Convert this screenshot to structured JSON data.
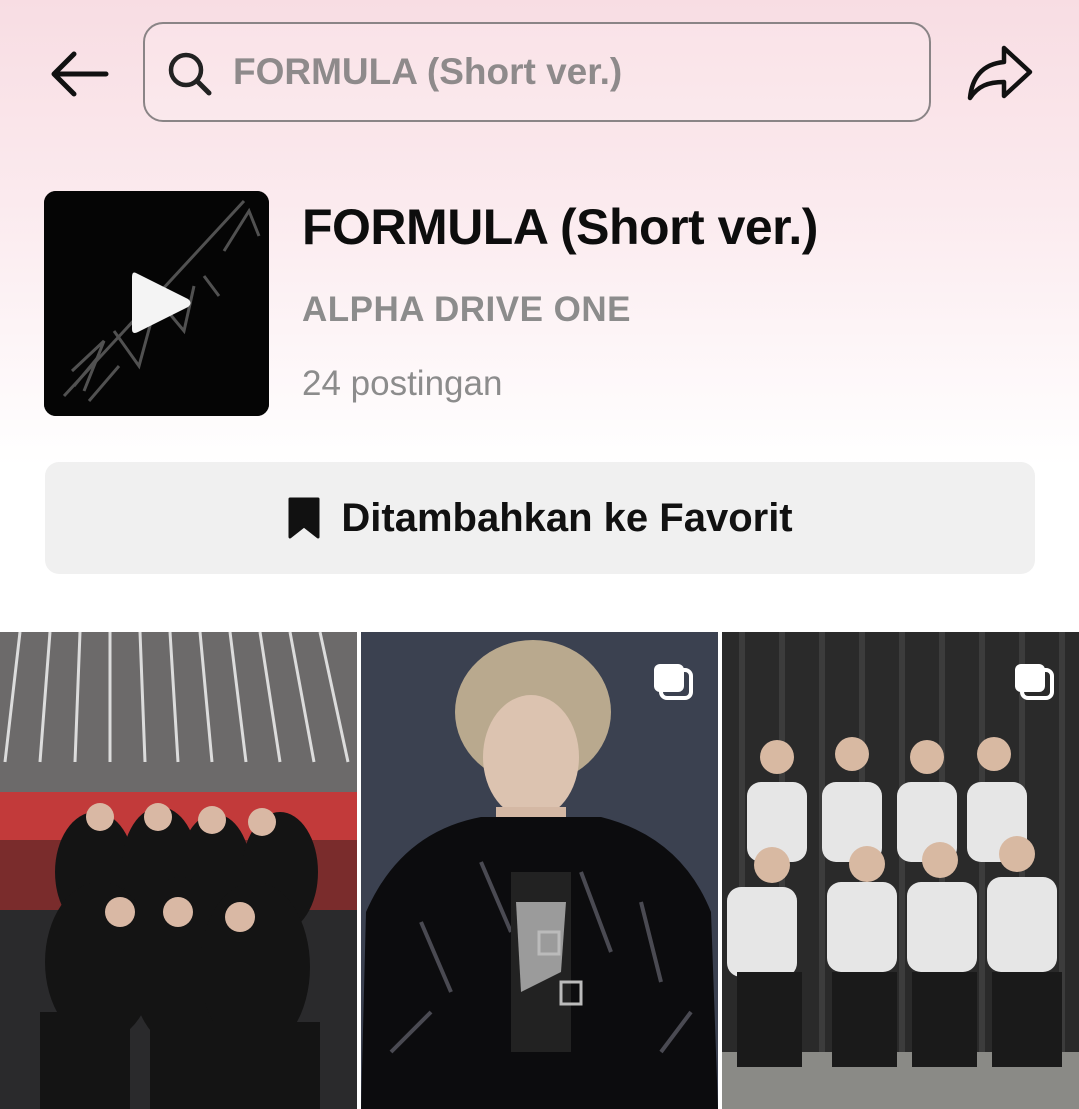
{
  "header": {
    "search_placeholder": "FORMULA (Short ver.)",
    "back_icon": "arrow-left-icon",
    "share_icon": "share-arrow-icon"
  },
  "sound": {
    "title": "FORMULA (Short ver.)",
    "artist": "ALPHA DRIVE ONE",
    "post_count": "24 postingan",
    "cover_icon": "play-icon"
  },
  "favorite": {
    "label": "Ditambahkan ke Favorit",
    "icon": "bookmark-filled-icon"
  },
  "posts": [
    {
      "type": "video"
    },
    {
      "type": "photo-carousel",
      "icon": "multi-image-icon"
    },
    {
      "type": "photo-carousel",
      "icon": "multi-image-icon"
    }
  ],
  "colors": {
    "header_gradient_top": "#f8dde3",
    "muted_text": "#8c8c8c",
    "button_bg": "#f0f0f0"
  }
}
